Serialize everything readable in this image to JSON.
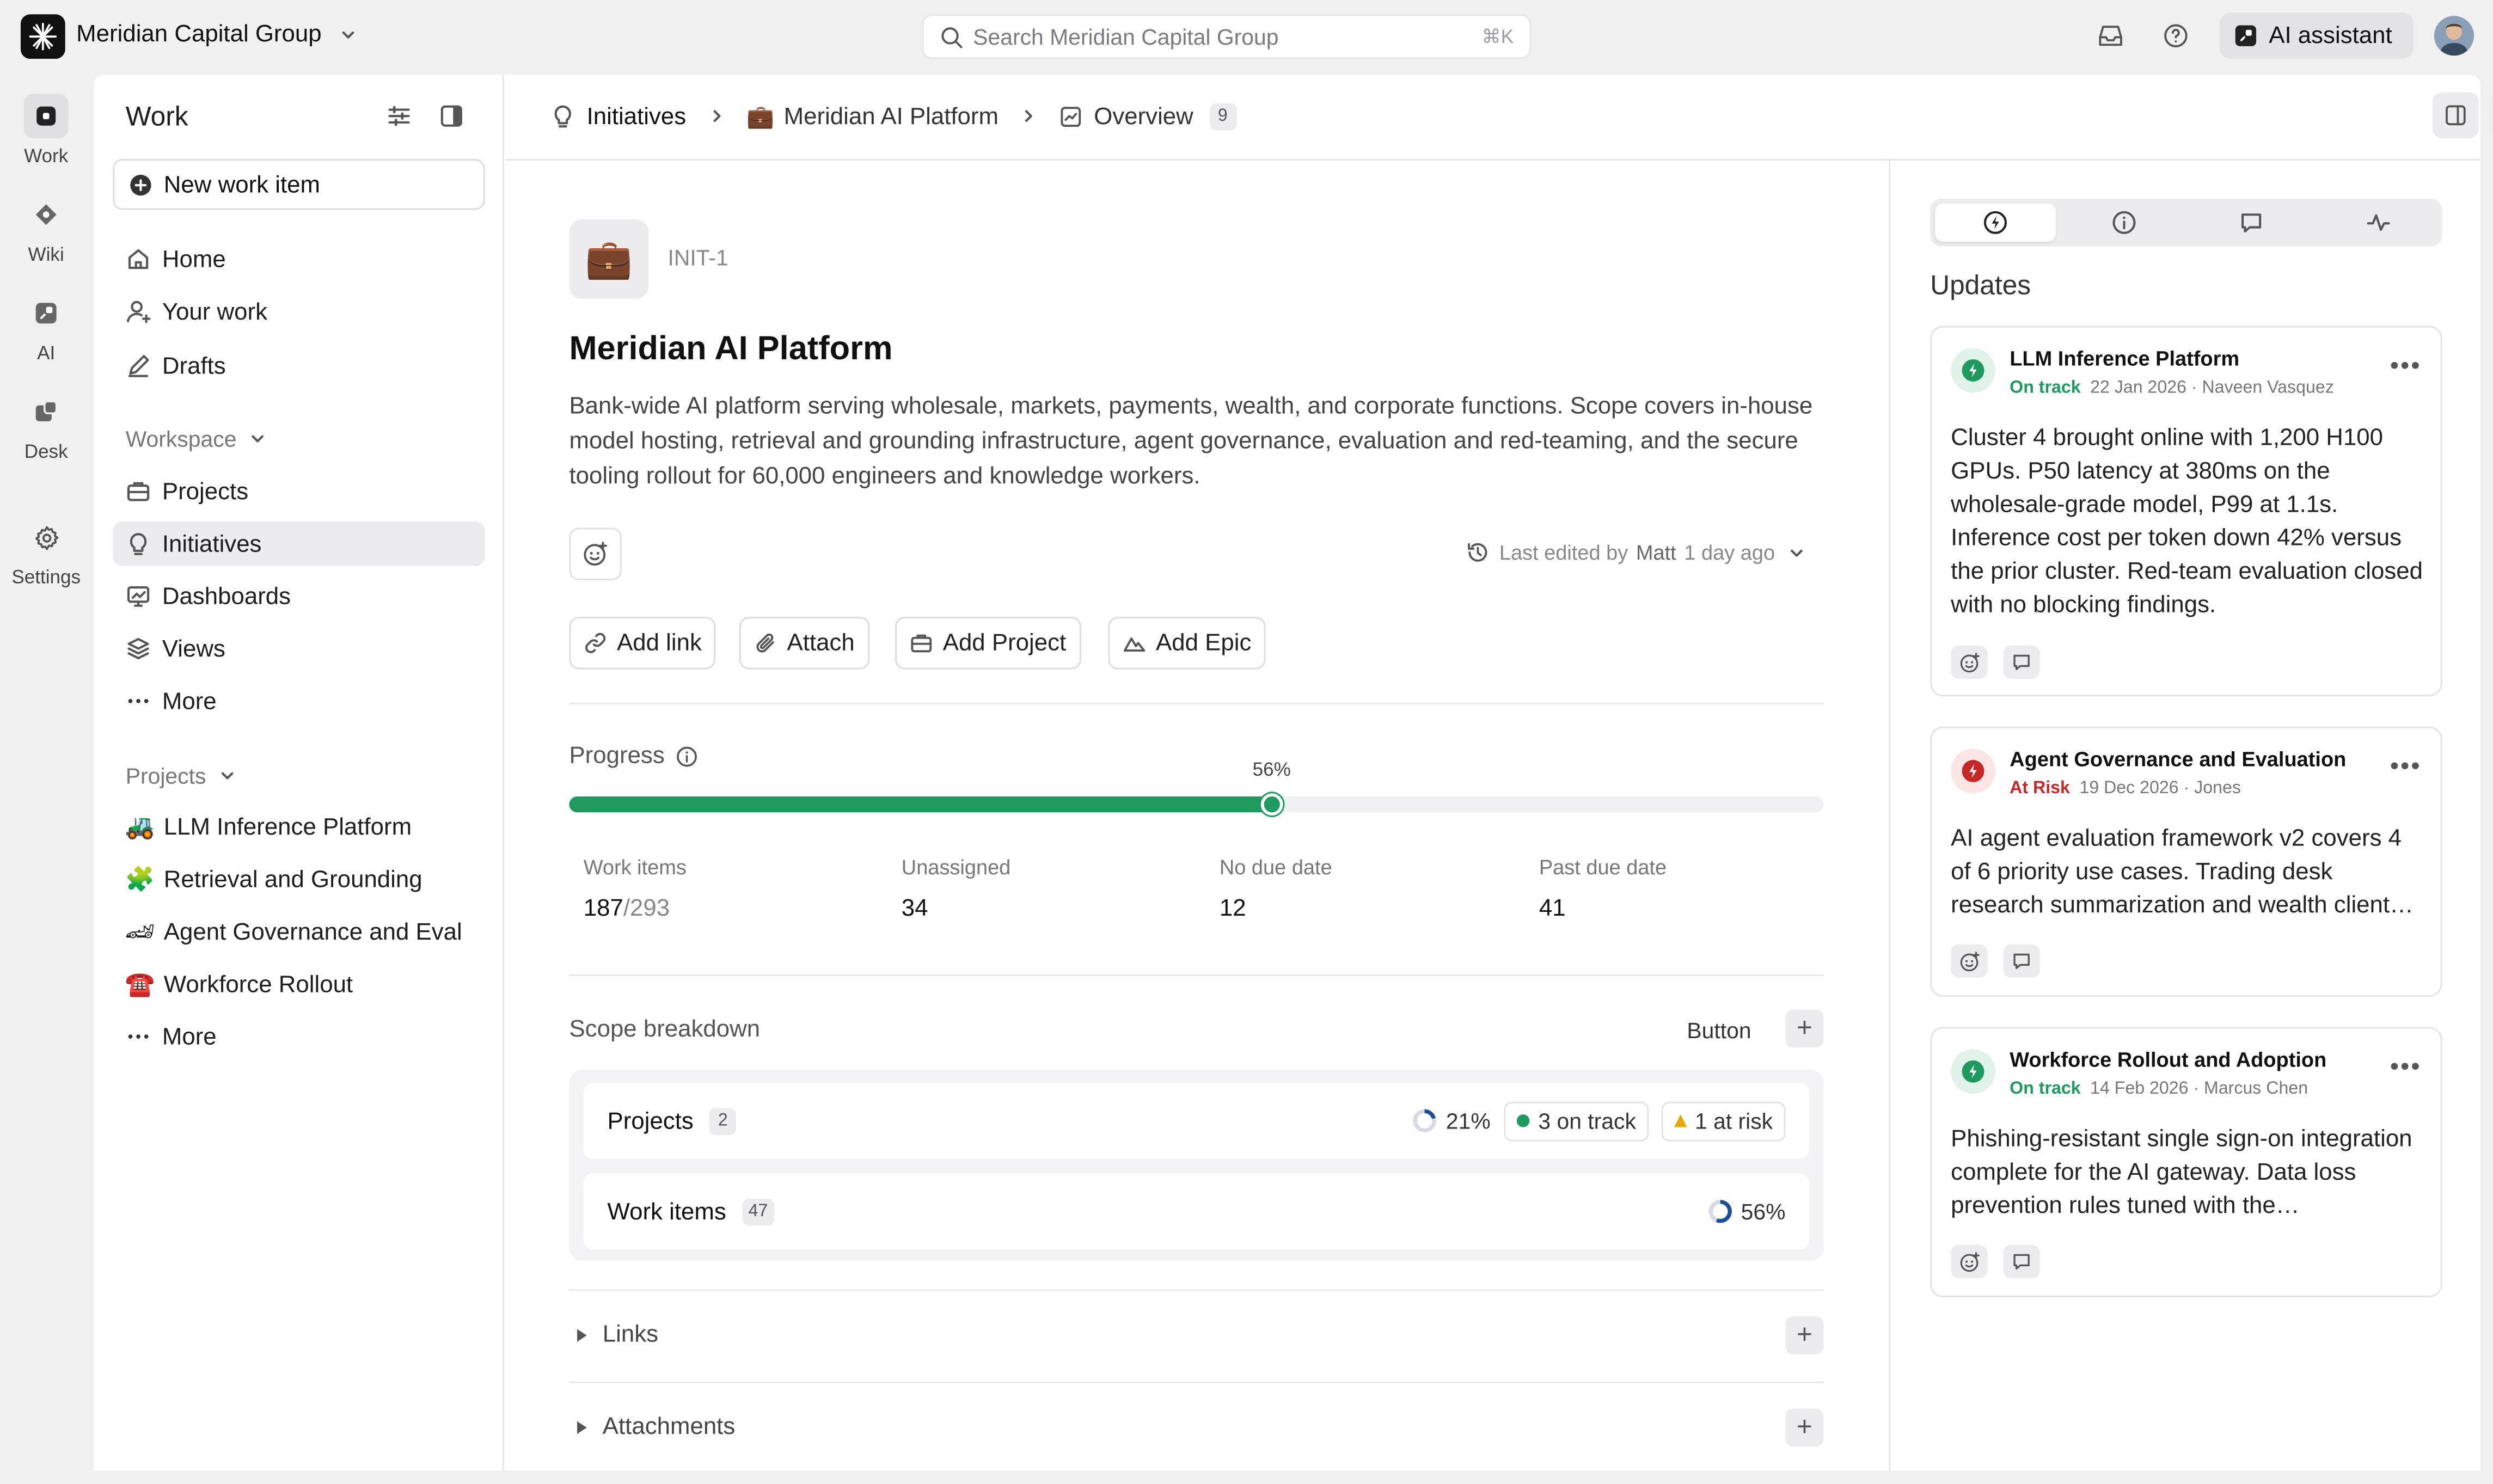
{
  "topbar": {
    "org_name": "Meridian Capital Group",
    "search_placeholder": "Search Meridian Capital Group",
    "search_shortcut": "⌘K",
    "ai_label": "AI assistant"
  },
  "rail": {
    "items": [
      {
        "label": "Work",
        "icon": "work-icon"
      },
      {
        "label": "Wiki",
        "icon": "wiki-icon"
      },
      {
        "label": "AI",
        "icon": "ai-icon"
      },
      {
        "label": "Desk",
        "icon": "desk-icon"
      },
      {
        "label": "Settings",
        "icon": "gear-icon"
      }
    ]
  },
  "sidebar": {
    "title": "Work",
    "new_item": "New work item",
    "nav": [
      {
        "label": "Home",
        "icon": "home-icon"
      },
      {
        "label": "Your work",
        "icon": "user-icon"
      },
      {
        "label": "Drafts",
        "icon": "pen-icon"
      }
    ],
    "workspace_label": "Workspace",
    "workspace": [
      {
        "label": "Projects",
        "icon": "briefcase-icon"
      },
      {
        "label": "Initiatives",
        "icon": "lightbulb-icon"
      },
      {
        "label": "Dashboards",
        "icon": "dashboard-icon"
      },
      {
        "label": "Views",
        "icon": "layers-icon"
      },
      {
        "label": "More",
        "icon": "more-icon"
      }
    ],
    "projects_label": "Projects",
    "projects": [
      {
        "label": "LLM Inference Platform",
        "emoji": "🚜"
      },
      {
        "label": "Retrieval and Grounding",
        "emoji": "🧩"
      },
      {
        "label": "Agent Governance and Eval",
        "emoji": "🏎"
      },
      {
        "label": "Workforce Rollout",
        "emoji": "☎️"
      },
      {
        "label": "More",
        "emoji": ""
      }
    ]
  },
  "breadcrumb": {
    "initiatives": "Initiatives",
    "platform": "Meridian AI Platform",
    "overview": "Overview",
    "overview_count": "9"
  },
  "initiative": {
    "emoji": "💼",
    "id": "INIT-1",
    "title": "Meridian AI Platform",
    "description": "Bank-wide AI platform serving wholesale, markets, payments, wealth, and corporate functions. Scope covers in-house model hosting, retrieval and grounding infrastructure, agent governance, evaluation and red-teaming, and the secure tooling rollout for 60,000 engineers and knowledge workers.",
    "edited_prefix": "Last edited by",
    "edited_by": "Matt",
    "edited_when": "1 day ago"
  },
  "actions": [
    {
      "label": "Add link",
      "icon": "link-icon"
    },
    {
      "label": "Attach",
      "icon": "paperclip-icon"
    },
    {
      "label": "Add Project",
      "icon": "briefcase-icon"
    },
    {
      "label": "Add Epic",
      "icon": "mountain-icon"
    }
  ],
  "progress": {
    "label": "Progress",
    "percent": 56,
    "percent_label": "56%",
    "stats": [
      {
        "label": "Work items",
        "value": "187",
        "total": "/293"
      },
      {
        "label": "Unassigned",
        "value": "34",
        "total": ""
      },
      {
        "label": "No due date",
        "value": "12",
        "total": ""
      },
      {
        "label": "Past due date",
        "value": "41",
        "total": ""
      }
    ]
  },
  "scope": {
    "label": "Scope breakdown",
    "button": "Button",
    "projects": {
      "label": "Projects",
      "count": "2",
      "pct": "21%",
      "pct_value": 21,
      "on_track": "3 on track",
      "at_risk": "1 at risk"
    },
    "work_items": {
      "label": "Work items",
      "count": "47",
      "pct": "56%",
      "pct_value": 56
    }
  },
  "sections": {
    "links": "Links",
    "attachments": "Attachments"
  },
  "updates": {
    "title": "Updates",
    "cards": [
      {
        "name": "LLM Inference Platform",
        "status": "On track",
        "date_author": "22 Jan 2026 · Naveen Vasquez",
        "body": "Cluster 4 brought online with 1,200 H100 GPUs. P50 latency at 380ms on the wholesale-grade model, P99 at 1.1s. Inference cost per token down 42% versus the prior cluster. Red-team evaluation closed with no blocking findings."
      },
      {
        "name": "Agent Governance and Evaluation",
        "status": "At Risk",
        "date_author": "19 Dec 2026 · Jones",
        "body": "AI agent evaluation framework v2 covers 4 of 6 priority use cases. Trading desk research summarization and wealth client…"
      },
      {
        "name": "Workforce Rollout and Adoption",
        "status": "On track",
        "date_author": "14 Feb 2026 · Marcus Chen",
        "body": "Phishing-resistant single sign-on integration complete for the AI gateway. Data loss prevention rules tuned with the…"
      }
    ]
  },
  "colors": {
    "on_track": "#1e9a5f",
    "at_risk": "#c62828",
    "progress": "#1e9a5f"
  }
}
